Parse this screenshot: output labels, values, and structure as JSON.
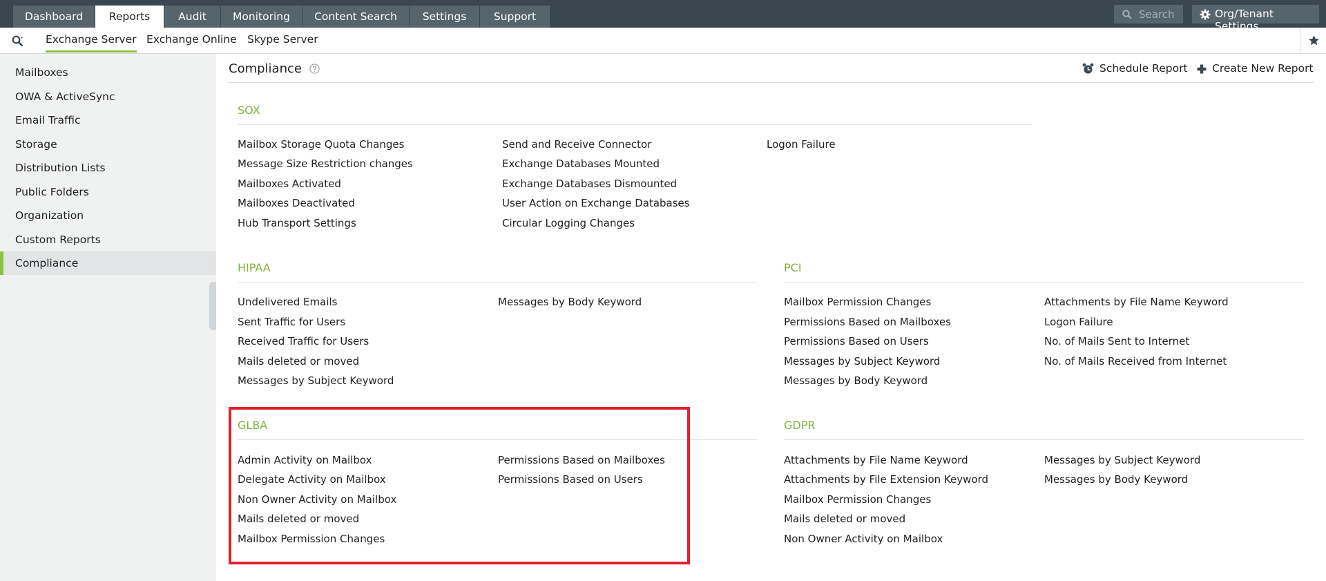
{
  "topnav": {
    "tabs": [
      "Dashboard",
      "Reports",
      "Audit",
      "Monitoring",
      "Content Search",
      "Settings",
      "Support"
    ],
    "active_tab": "Reports",
    "search_placeholder": "Search",
    "org_button": "Org/Tenant Settings"
  },
  "subnav": {
    "tabs": [
      "Exchange Server",
      "Exchange Online",
      "Skype Server"
    ],
    "active_tab": "Exchange Server"
  },
  "sidebar": {
    "items": [
      "Mailboxes",
      "OWA & ActiveSync",
      "Email Traffic",
      "Storage",
      "Distribution Lists",
      "Public Folders",
      "Organization",
      "Custom Reports",
      "Compliance"
    ],
    "active_item": "Compliance"
  },
  "page": {
    "title": "Compliance",
    "actions": {
      "schedule": "Schedule Report",
      "create": "Create New Report"
    }
  },
  "sections": {
    "sox": {
      "title": "SOX",
      "columns": [
        [
          "Mailbox Storage Quota Changes",
          "Message Size Restriction changes",
          "Mailboxes Activated",
          "Mailboxes Deactivated",
          "Hub Transport Settings"
        ],
        [
          "Send and Receive Connector",
          "Exchange Databases Mounted",
          "Exchange Databases Dismounted",
          "User Action on Exchange Databases",
          "Circular Logging Changes"
        ],
        [
          "Logon Failure"
        ]
      ]
    },
    "hipaa": {
      "title": "HIPAA",
      "columns": [
        [
          "Undelivered Emails",
          "Sent Traffic for Users",
          "Received Traffic for Users",
          "Mails deleted or moved",
          "Messages by Subject Keyword"
        ],
        [
          "Messages by Body Keyword"
        ]
      ]
    },
    "pci": {
      "title": "PCI",
      "columns": [
        [
          "Mailbox Permission Changes",
          "Permissions Based on Mailboxes",
          "Permissions Based on Users",
          "Messages by Subject Keyword",
          "Messages by Body Keyword"
        ],
        [
          "Attachments by File Name Keyword",
          "Logon Failure",
          "No. of Mails Sent to Internet",
          "No. of Mails Received from Internet"
        ]
      ]
    },
    "glba": {
      "title": "GLBA",
      "columns": [
        [
          "Admin Activity on Mailbox",
          "Delegate Activity on Mailbox",
          "Non Owner Activity on Mailbox",
          "Mails deleted or moved",
          "Mailbox Permission Changes"
        ],
        [
          "Permissions Based on Mailboxes",
          "Permissions Based on Users"
        ]
      ]
    },
    "gdpr": {
      "title": "GDPR",
      "columns": [
        [
          "Attachments by File Name Keyword",
          "Attachments by File Extension Keyword",
          "Mailbox Permission Changes",
          "Mails deleted or moved",
          "Non Owner Activity on Mailbox"
        ],
        [
          "Messages by Subject Keyword",
          "Messages by Body Keyword"
        ]
      ]
    }
  },
  "colors": {
    "topbar": "#3a4750",
    "tab": "#56646c",
    "accent_green": "#8cc23f",
    "section_title": "#7fb13f",
    "highlight": "#e0212e",
    "sidebar_bg": "#f0f1f1"
  }
}
